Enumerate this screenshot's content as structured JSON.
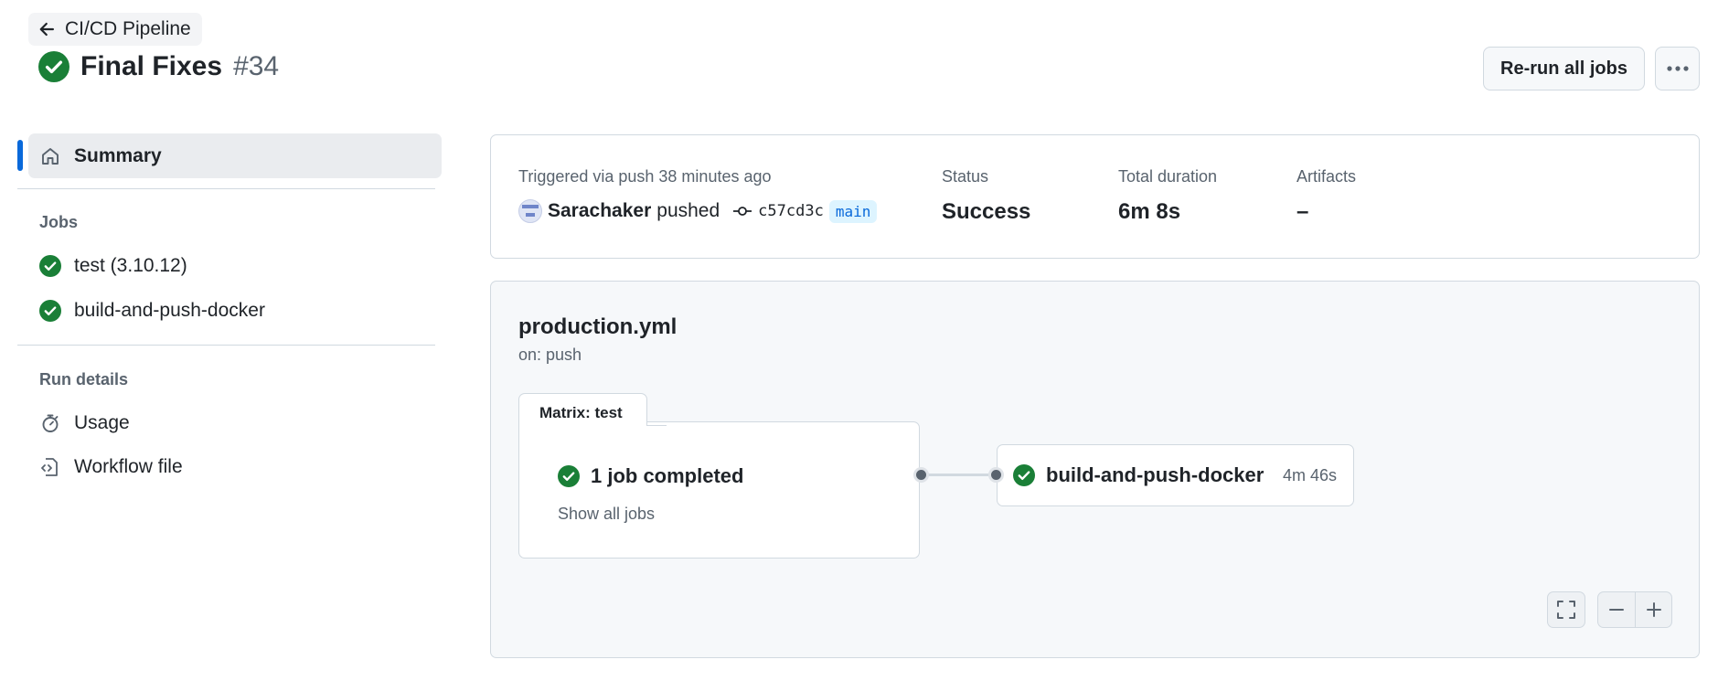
{
  "back_link": {
    "label": "CI/CD Pipeline"
  },
  "run": {
    "title": "Final Fixes",
    "number": "#34",
    "status": "success"
  },
  "header_actions": {
    "rerun_label": "Re-run all jobs",
    "more_icon": "kebab-horizontal-icon"
  },
  "sidebar": {
    "summary_label": "Summary",
    "jobs_heading": "Jobs",
    "jobs": [
      {
        "label": "test (3.10.12)",
        "status": "success"
      },
      {
        "label": "build-and-push-docker",
        "status": "success"
      }
    ],
    "run_details_heading": "Run details",
    "run_details": [
      {
        "label": "Usage",
        "icon": "stopwatch-icon"
      },
      {
        "label": "Workflow file",
        "icon": "file-code-icon"
      }
    ]
  },
  "summary": {
    "trigger_text": "Triggered via push 38 minutes ago",
    "actor": "Sarachaker",
    "action": "pushed",
    "commit_sha": "c57cd3c",
    "branch": "main",
    "status_label": "Status",
    "status_value": "Success",
    "duration_label": "Total duration",
    "duration_value": "6m 8s",
    "artifacts_label": "Artifacts",
    "artifacts_value": "–"
  },
  "workflow": {
    "file_name": "production.yml",
    "trigger": "on: push",
    "matrix_label": "Matrix: test",
    "matrix_status": "1 job completed",
    "show_all_label": "Show all jobs",
    "job_name": "build-and-push-docker",
    "job_duration": "4m 46s"
  },
  "colors": {
    "success": "#1a7f37",
    "accent": "#0969da",
    "muted": "#59636e"
  }
}
